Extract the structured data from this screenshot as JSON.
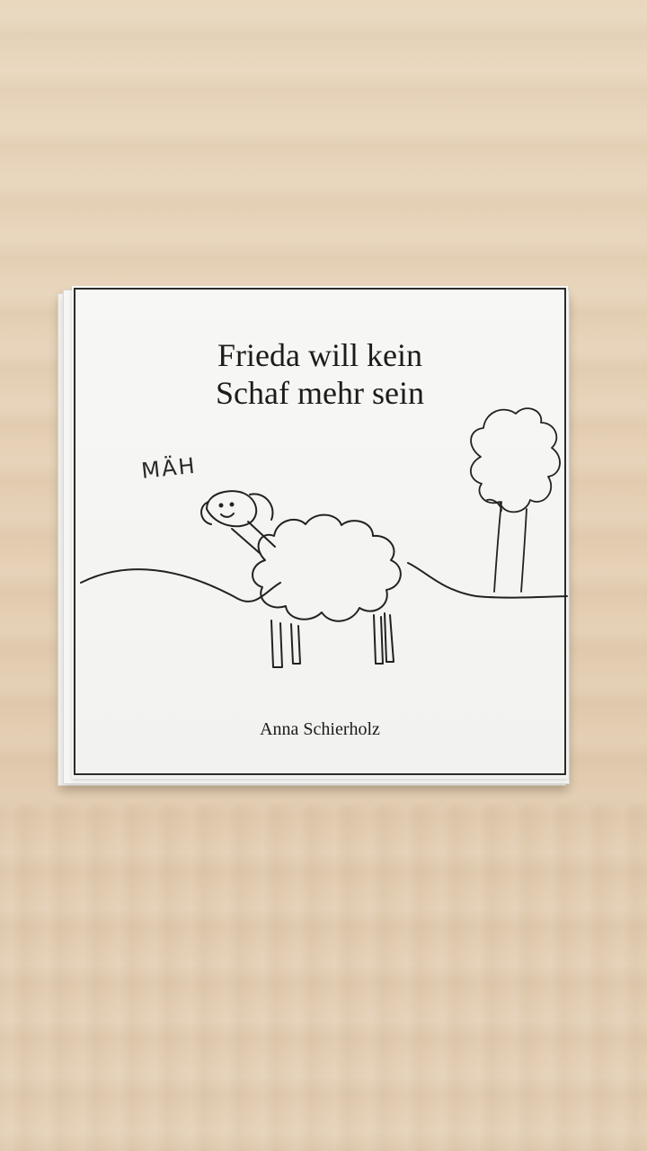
{
  "cover": {
    "title_line1": "Frieda will kein",
    "title_line2": "Schaf mehr sein",
    "author": "Anna Schierholz",
    "sheep_sound": "MÄH"
  },
  "icons": {
    "sheep": "sheep-drawing-icon",
    "tree": "tree-drawing-icon",
    "hill": "hill-line-icon"
  },
  "colors": {
    "ink": "#1c1c1c",
    "paper": "#f6f6f4",
    "wood": "#e6d1b6"
  }
}
